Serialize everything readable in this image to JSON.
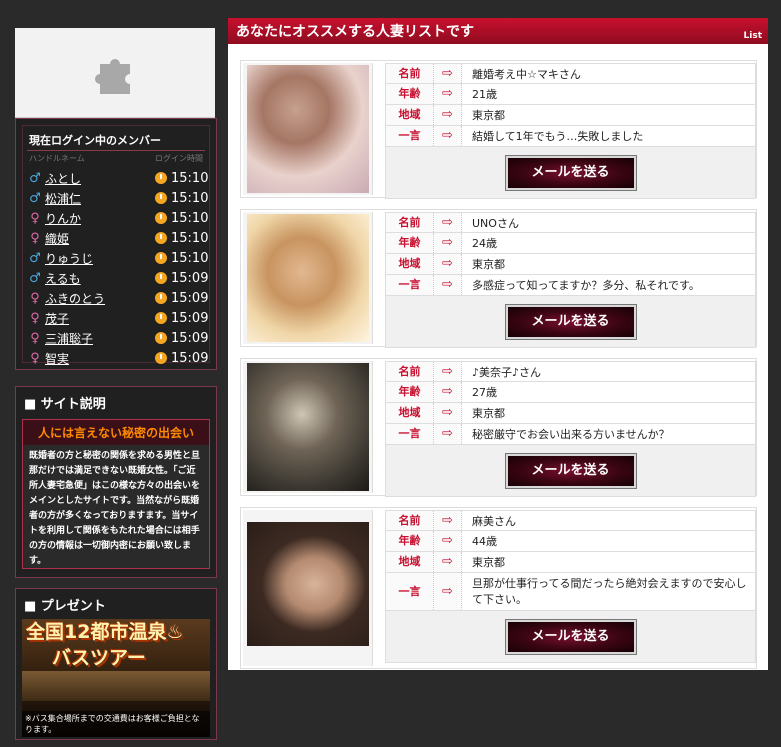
{
  "sidebar": {
    "members": {
      "title": "現在ログイン中のメンバー",
      "col_name": "ハンドルネーム",
      "col_time": "ログイン時間",
      "items": [
        {
          "gender": "male",
          "name": "ふとし",
          "time": "15:10"
        },
        {
          "gender": "male",
          "name": "松浦仁",
          "time": "15:10"
        },
        {
          "gender": "female",
          "name": "りんか",
          "time": "15:10"
        },
        {
          "gender": "female",
          "name": "織姫",
          "time": "15:10"
        },
        {
          "gender": "male",
          "name": "りゅうじ",
          "time": "15:10"
        },
        {
          "gender": "male",
          "name": "えるも",
          "time": "15:09"
        },
        {
          "gender": "female",
          "name": "ふきのとう",
          "time": "15:09"
        },
        {
          "gender": "female",
          "name": "茂子",
          "time": "15:09"
        },
        {
          "gender": "female",
          "name": "三浦聡子",
          "time": "15:09"
        },
        {
          "gender": "female",
          "name": "智実",
          "time": "15:09"
        }
      ]
    },
    "about": {
      "title": "■ サイト説明",
      "catch": "人には言えない秘密の出会い",
      "body": "既婚者の方と秘密の関係を求める男性と旦那だけでは満足できない既婚女性。「ご近所人妻宅急便」はこの様な方々の出会いをメインとしたサイトです。当然ながら既婚者の方が多くなっておりますます。当サイトを利用して関係をもたれた場合には相手の方の情報は一切御内密にお願い致します。"
    },
    "present": {
      "title": "■ プレゼント",
      "banner_line1": "全国12都市温泉♨",
      "banner_line2": "バスツアー",
      "banner_note": "※バス集合場所までの交通費はお客様ご負担となります。"
    }
  },
  "main": {
    "title": "あなたにオススメする人妻リストです",
    "list_label": "List",
    "labels": {
      "name": "名前",
      "age": "年齢",
      "area": "地域",
      "comment": "一言"
    },
    "button_label": "メールを送る",
    "profiles": [
      {
        "name": "離婚考え中☆マキさん",
        "age": "21歳",
        "area": "東京都",
        "comment": "結婚して1年でもう…失敗しました"
      },
      {
        "name": "UNOさん",
        "age": "24歳",
        "area": "東京都",
        "comment": "多感症って知ってますか？多分、私それです。"
      },
      {
        "name": "♪美奈子♪さん",
        "age": "27歳",
        "area": "東京都",
        "comment": "秘密厳守でお会い出来る方いませんか？"
      },
      {
        "name": "麻美さん",
        "age": "44歳",
        "area": "東京都",
        "comment": "旦那が仕事行ってる間だったら絶対会えますので安心して下さい。"
      }
    ]
  }
}
